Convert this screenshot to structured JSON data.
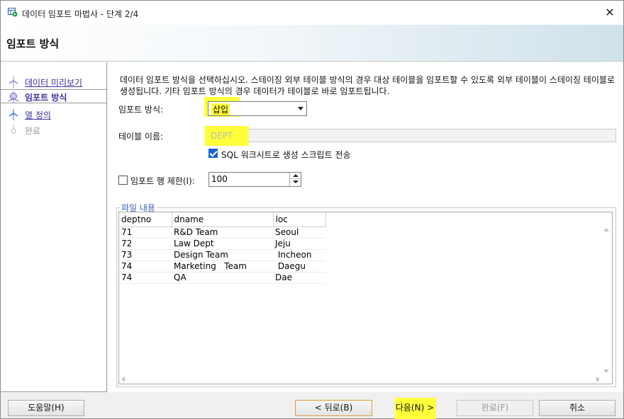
{
  "window": {
    "title": "데이터 임포트 마법사 - 단계 2/4",
    "close_glyph": "✕"
  },
  "header": {
    "title": "임포트 방식"
  },
  "steps": [
    {
      "label": "데이터 미리보기",
      "state": "link"
    },
    {
      "label": "임포트 방식",
      "state": "active"
    },
    {
      "label": "열 정의",
      "state": "link"
    },
    {
      "label": "완료",
      "state": "disabled"
    }
  ],
  "main": {
    "description": "데이터 임포트 방식을 선택하십시오. 스테이징 외부 테이블 방식의 경우 대상 테이블을 임포트할 수 있도록 외부 테이블이 스테이징 테이블로 생성됩니다. 기타 임포트 방식의 경우 데이터가 테이블로 바로 임포트됩니다.",
    "import_method": {
      "label": "임포트 방식:",
      "value": "삽입"
    },
    "table_name": {
      "label": "테이블 이름:",
      "value": "DEPT"
    },
    "send_script": {
      "label": "SQL 워크시트로 생성 스크립트 전송",
      "checked": true
    },
    "row_limit": {
      "label": "임포트 행 제한(I):",
      "value": "100",
      "checked": false
    },
    "file_contents": {
      "legend": "파일 내용",
      "columns": [
        "deptno",
        "dname",
        "loc"
      ],
      "rows": [
        [
          "71",
          "R&D Team",
          "Seoul"
        ],
        [
          "72",
          "Law Dept",
          "Jeju"
        ],
        [
          "73",
          "Design Team",
          " Incheon"
        ],
        [
          "74",
          "Marketing   Team",
          " Daegu"
        ],
        [
          "74",
          "QA",
          "Dae"
        ]
      ]
    }
  },
  "footer": {
    "help": "도움말(H)",
    "back": "< 뒤로(B)",
    "next": "다음(N) >",
    "finish": "완료(F)",
    "cancel": "취소"
  },
  "colors": {
    "highlight": "#ffff3a",
    "link": "#3a2f9a",
    "legend": "#3a63c0"
  }
}
